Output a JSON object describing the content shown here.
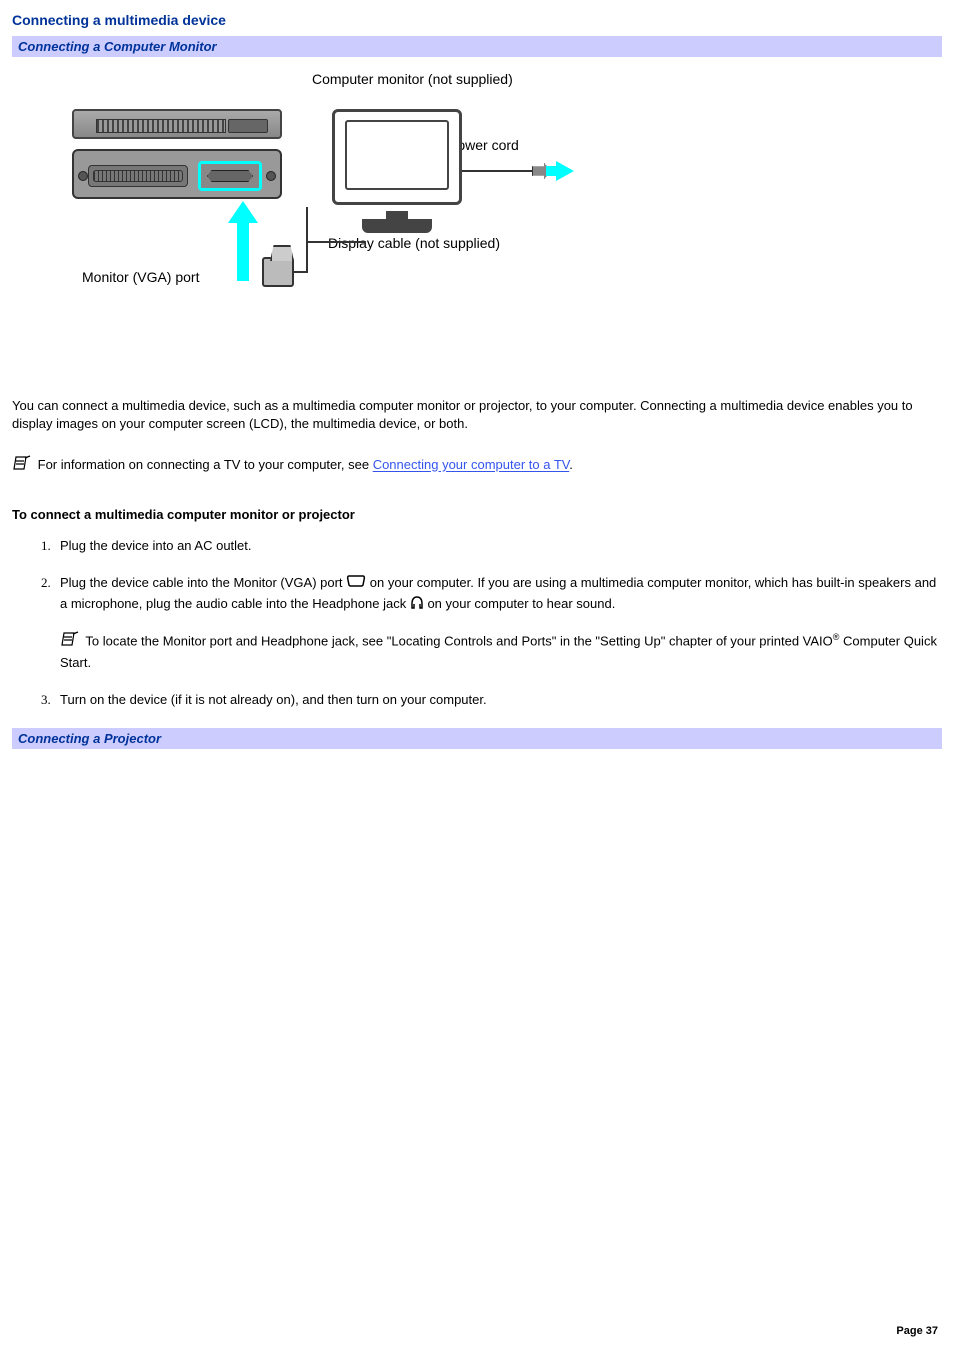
{
  "heading": "Connecting a multimedia device",
  "section1": "Connecting a Computer Monitor",
  "diagram": {
    "monitor_label": "Computer monitor (not supplied)",
    "power_cord": "Power cord",
    "display_cable": "Display cable (not supplied)",
    "vga_port": "Monitor (VGA) port"
  },
  "intro": "You can connect a multimedia device, such as a multimedia computer monitor or projector, to your computer. Connecting a multimedia device enables you to display images on your computer screen (LCD), the multimedia device, or both.",
  "note1_before": " For information on connecting a TV to your computer, see ",
  "note1_link": "Connecting your computer to a TV",
  "note1_after": ".",
  "sub_heading": "To connect a multimedia computer monitor or projector",
  "steps": {
    "s1": "Plug the device into an AC outlet.",
    "s2_a": "Plug the device cable into the Monitor (VGA) port ",
    "s2_b": " on your computer. If you are using a multimedia computer monitor, which has built-in speakers and a microphone, plug the audio cable into the Headphone jack ",
    "s2_c": " on your computer to hear sound.",
    "s2_note_a": " To locate the Monitor port and Headphone jack, see \"Locating Controls and Ports\" in the \"Setting Up\" chapter of your printed VAIO",
    "s2_note_reg": "®",
    "s2_note_b": " Computer Quick Start.",
    "s3": "Turn on the device (if it is not already on), and then turn on your computer."
  },
  "section2": "Connecting a Projector",
  "footer": "Page 37"
}
